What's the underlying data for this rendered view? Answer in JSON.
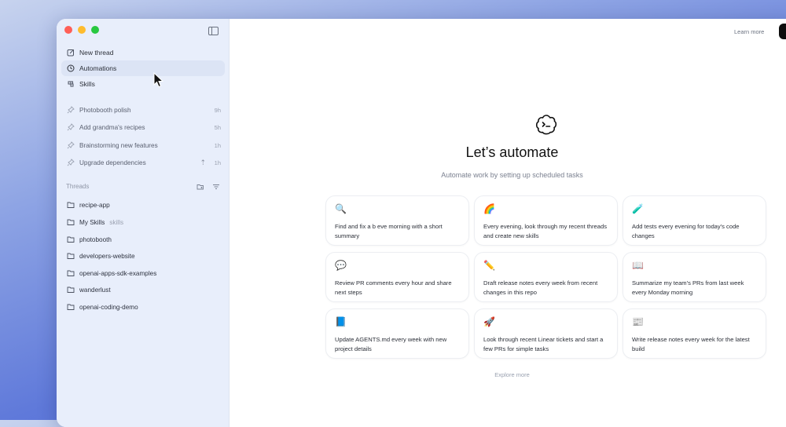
{
  "sidebar": {
    "nav": [
      {
        "label": "New thread",
        "icon": "edit-icon"
      },
      {
        "label": "Automations",
        "icon": "clock-icon"
      },
      {
        "label": "Skills",
        "icon": "skills-icon"
      }
    ],
    "pinned": [
      {
        "label": "Photobooth polish",
        "age": "9h"
      },
      {
        "label": "Add grandma's recipes",
        "age": "5h"
      },
      {
        "label": "Brainstorming new features",
        "age": "1h"
      },
      {
        "label": "Upgrade dependencies",
        "age": "1h",
        "branch": "⇡"
      }
    ],
    "threads_title": "Threads",
    "threads": [
      {
        "label": "recipe-app"
      },
      {
        "label": "My Skills",
        "sub": "skills"
      },
      {
        "label": "photobooth"
      },
      {
        "label": "developers-website"
      },
      {
        "label": "openai-apps-sdk-examples"
      },
      {
        "label": "wanderlust"
      },
      {
        "label": "openai-coding-demo"
      }
    ]
  },
  "header": {
    "learn_more": "Learn more"
  },
  "main": {
    "title": "Let’s automate",
    "subtitle": "Automate work by setting up scheduled tasks",
    "cards": [
      {
        "emoji": "🔍",
        "text": "Find and fix a b   eve  morning with a short summary"
      },
      {
        "emoji": "🌈",
        "text": "Every evening, look through my recent threads and create new skills"
      },
      {
        "emoji": "🧪",
        "text": "Add tests every evening for today's code changes"
      },
      {
        "emoji": "💬",
        "text": "Review PR comments every hour and share next steps"
      },
      {
        "emoji": "✏️",
        "text": "Draft release notes every week from recent changes in this repo"
      },
      {
        "emoji": "📖",
        "text": "Summarize my team's PRs from last week every Monday morning"
      },
      {
        "emoji": "📘",
        "text": "Update AGENTS.md every week with new project details"
      },
      {
        "emoji": "🚀",
        "text": "Look through recent Linear tickets and start a few PRs for simple tasks"
      },
      {
        "emoji": "📰",
        "text": "Write release notes every week for the latest build"
      }
    ],
    "explore_more": "Explore more"
  }
}
